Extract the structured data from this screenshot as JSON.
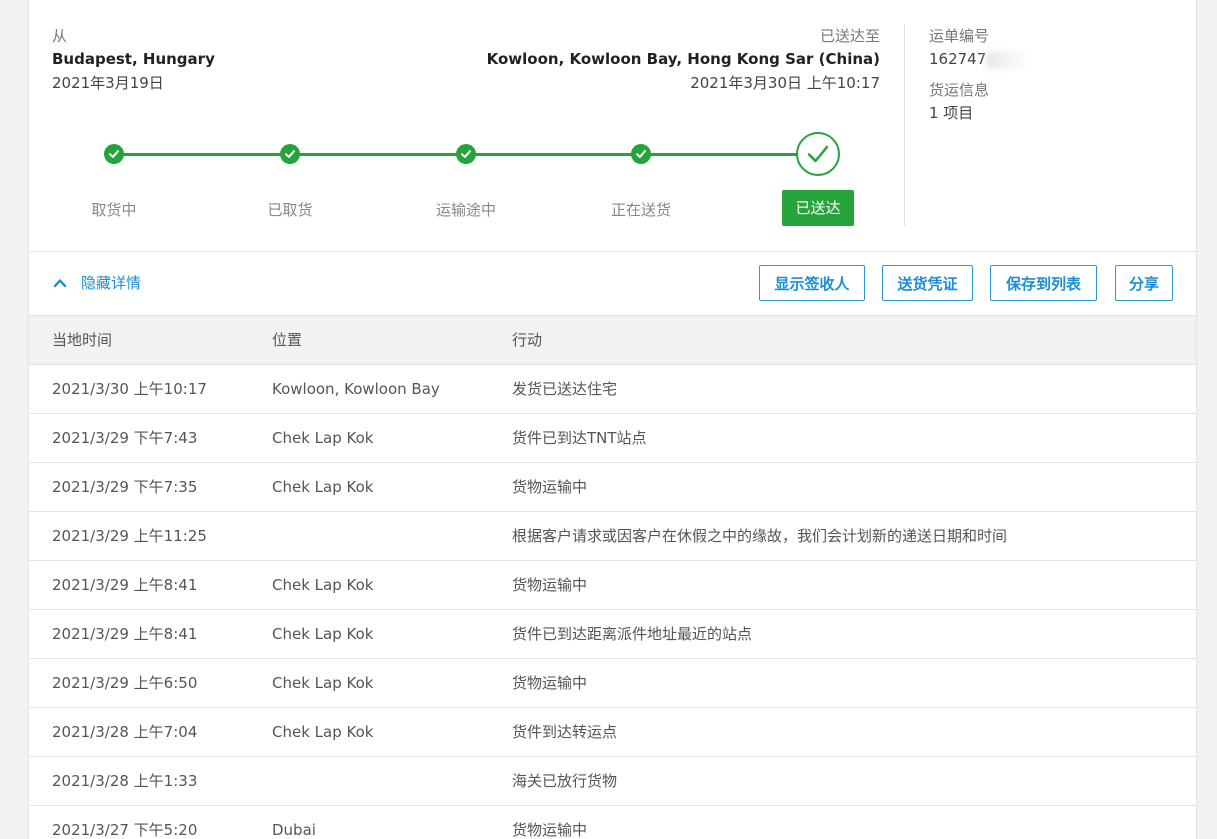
{
  "shipment": {
    "from_label": "从",
    "from_place": "Budapest, Hungary",
    "from_date": "2021年3月19日",
    "to_label": "已送达至",
    "to_place": "Kowloon, Kowloon Bay, Hong Kong Sar (China)",
    "to_date": "2021年3月30日 上午10:17"
  },
  "info": {
    "waybill_label": "运单编号",
    "waybill_value": "162747",
    "cargo_label": "货运信息",
    "cargo_value": "1 项目"
  },
  "progress": {
    "steps": [
      "取货中",
      "已取货",
      "运输途中",
      "正在送货",
      "已送达"
    ],
    "current_step": 5,
    "accent_color": "#27a33c"
  },
  "actions": {
    "toggle_label": "隐藏详情",
    "buttons": [
      "显示签收人",
      "送货凭证",
      "保存到列表",
      "分享"
    ]
  },
  "table": {
    "headers": [
      "当地时间",
      "位置",
      "行动"
    ],
    "rows": [
      [
        "2021/3/30 上午10:17",
        "Kowloon, Kowloon Bay",
        "发货已送达住宅"
      ],
      [
        "2021/3/29 下午7:43",
        "Chek Lap Kok",
        "货件已到达TNT站点"
      ],
      [
        "2021/3/29 下午7:35",
        "Chek Lap Kok",
        "货物运输中"
      ],
      [
        "2021/3/29 上午11:25",
        "",
        "根据客户请求或因客户在休假之中的缘故，我们会计划新的递送日期和时间"
      ],
      [
        "2021/3/29 上午8:41",
        "Chek Lap Kok",
        "货物运输中"
      ],
      [
        "2021/3/29 上午8:41",
        "Chek Lap Kok",
        "货件已到达距离派件地址最近的站点"
      ],
      [
        "2021/3/29 上午6:50",
        "Chek Lap Kok",
        "货物运输中"
      ],
      [
        "2021/3/28 上午7:04",
        "Chek Lap Kok",
        "货件到达转运点"
      ],
      [
        "2021/3/28 上午1:33",
        "",
        "海关已放行货物"
      ],
      [
        "2021/3/27 下午5:20",
        "Dubai",
        "货物运输中"
      ]
    ]
  }
}
